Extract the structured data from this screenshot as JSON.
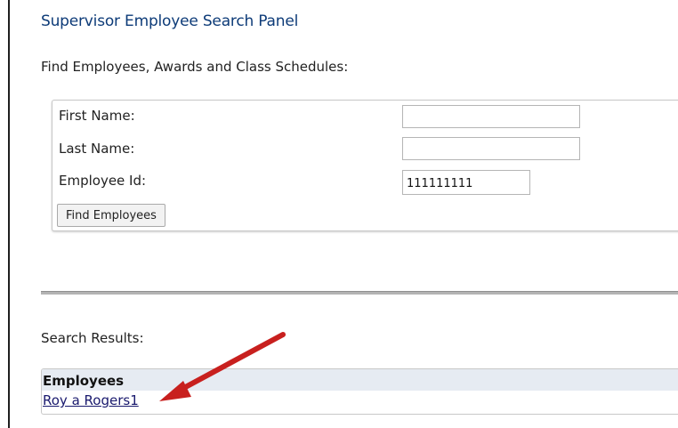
{
  "panel": {
    "title": "Supervisor Employee Search Panel",
    "intro": "Find Employees, Awards and Class Schedules:"
  },
  "search_form": {
    "first_name_label": "First Name:",
    "first_name_value": "",
    "last_name_label": "Last Name:",
    "last_name_value": "",
    "employee_id_label": "Employee Id:",
    "employee_id_value": "111111111",
    "find_button_label": "Find Employees"
  },
  "results": {
    "label": "Search Results:",
    "header": "Employees",
    "items": [
      {
        "name": "Roy a Rogers1"
      }
    ]
  },
  "annotation": {
    "arrow_color": "#c8201e"
  }
}
